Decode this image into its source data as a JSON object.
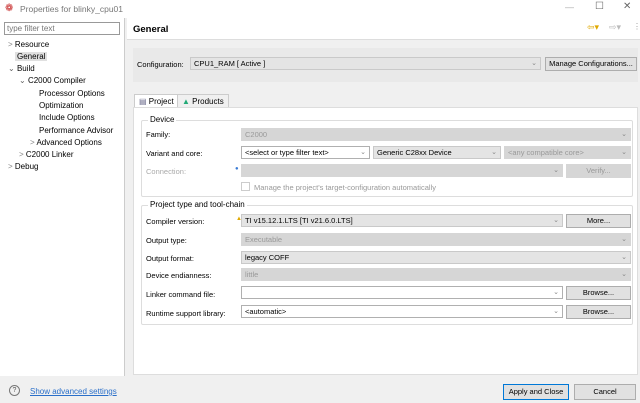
{
  "window": {
    "title": "Properties for blinky_cpu01",
    "app_icon": "ti-logo-icon",
    "controls": [
      "minimize",
      "maximize",
      "close"
    ]
  },
  "sidebar": {
    "filter_placeholder": "type filter text",
    "items": [
      {
        "label": "Resource",
        "indent": 0,
        "expander": ">"
      },
      {
        "label": "General",
        "indent": 0,
        "expander": "",
        "selected": true
      },
      {
        "label": "Build",
        "indent": 0,
        "expander": "v"
      },
      {
        "label": "C2000 Compiler",
        "indent": 1,
        "expander": "v"
      },
      {
        "label": "Processor Options",
        "indent": 2,
        "expander": ""
      },
      {
        "label": "Optimization",
        "indent": 2,
        "expander": ""
      },
      {
        "label": "Include Options",
        "indent": 2,
        "expander": ""
      },
      {
        "label": "Performance Advisor",
        "indent": 2,
        "expander": ""
      },
      {
        "label": "Advanced Options",
        "indent": 2,
        "expander": ">"
      },
      {
        "label": "C2000 Linker",
        "indent": 1,
        "expander": ">"
      },
      {
        "label": "Debug",
        "indent": 0,
        "expander": ">"
      }
    ]
  },
  "header": {
    "title": "General"
  },
  "configuration": {
    "label": "Configuration:",
    "value": "CPU1_RAM  [ Active ]",
    "manage_button": "Manage Configurations..."
  },
  "tabs": [
    {
      "label": "Project",
      "active": true
    },
    {
      "label": "Products",
      "active": false
    }
  ],
  "device": {
    "group_label": "Device",
    "family": {
      "label": "Family:",
      "value": "C2000"
    },
    "variant": {
      "label": "Variant and core:",
      "filter": "<select or type filter text>",
      "device": "Generic C28xx Device",
      "core": "<any compatible core>"
    },
    "connection": {
      "label": "Connection:",
      "value": "",
      "verify_button": "Verify..."
    },
    "manage_checkbox": {
      "label": "Manage the project's target-configuration automatically",
      "checked": false
    }
  },
  "toolchain": {
    "group_label": "Project type and tool-chain",
    "compiler": {
      "label": "Compiler version:",
      "value": "TI v15.12.1.LTS  [TI v21.6.0.LTS]",
      "button": "More..."
    },
    "output_type": {
      "label": "Output type:",
      "value": "Executable"
    },
    "output_format": {
      "label": "Output format:",
      "value": "legacy COFF"
    },
    "endianness": {
      "label": "Device endianness:",
      "value": "little"
    },
    "linker_file": {
      "label": "Linker command file:",
      "value": "",
      "button": "Browse..."
    },
    "runtime_lib": {
      "label": "Runtime support library:",
      "value": "<automatic>",
      "button": "Browse..."
    }
  },
  "footer": {
    "advanced_link": "Show advanced settings",
    "apply_close": "Apply and Close",
    "cancel": "Cancel"
  }
}
